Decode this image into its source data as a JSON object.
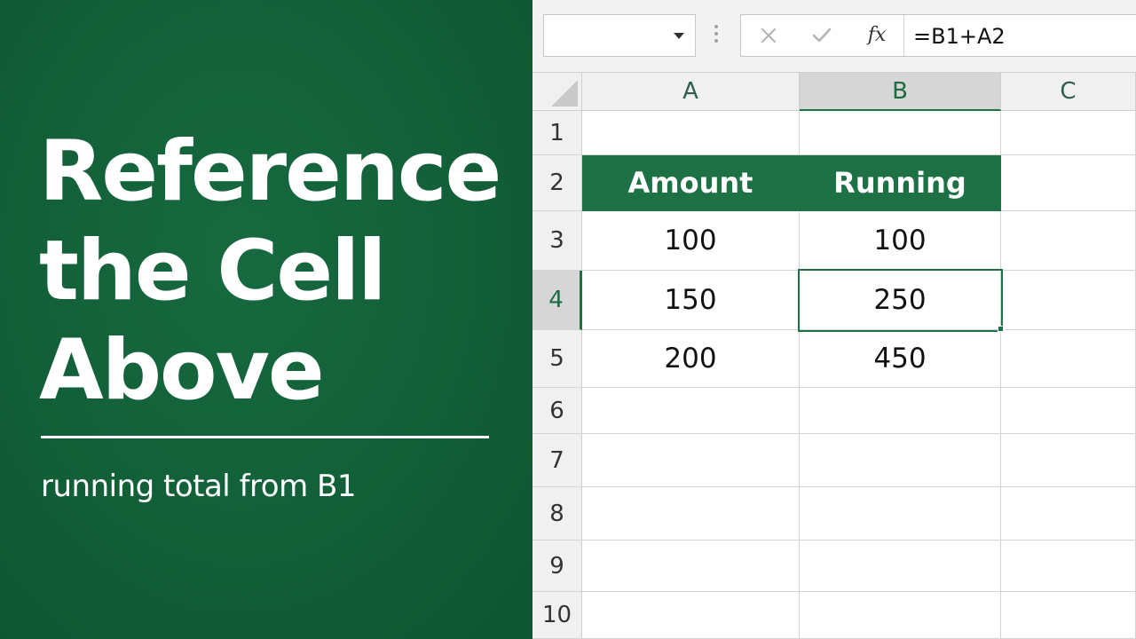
{
  "title": {
    "line1": "Reference",
    "line2": "the Cell",
    "line3": "Above",
    "subtitle": "running total from B1"
  },
  "colors": {
    "panel_green": "#125f38",
    "excel_green": "#1e7145",
    "header_gray": "#f0f0f0",
    "active_header_gray": "#d6d6d6"
  },
  "formula_bar": {
    "name_box_value": "",
    "cancel_icon": "x-icon",
    "enter_icon": "check-icon",
    "function_icon": "fx",
    "formula": "=B1+A2"
  },
  "sheet": {
    "columns": [
      "A",
      "B",
      "C"
    ],
    "active_column": "B",
    "rows": [
      "1",
      "2",
      "3",
      "4",
      "5",
      "6",
      "7",
      "8",
      "9",
      "10"
    ],
    "active_row": "4",
    "selected_cell": "B4",
    "cells": {
      "A2": "Amount",
      "B2": "Running",
      "A3": "100",
      "B3": "100",
      "A4": "150",
      "B4": "250",
      "A5": "200",
      "B5": "450"
    }
  }
}
